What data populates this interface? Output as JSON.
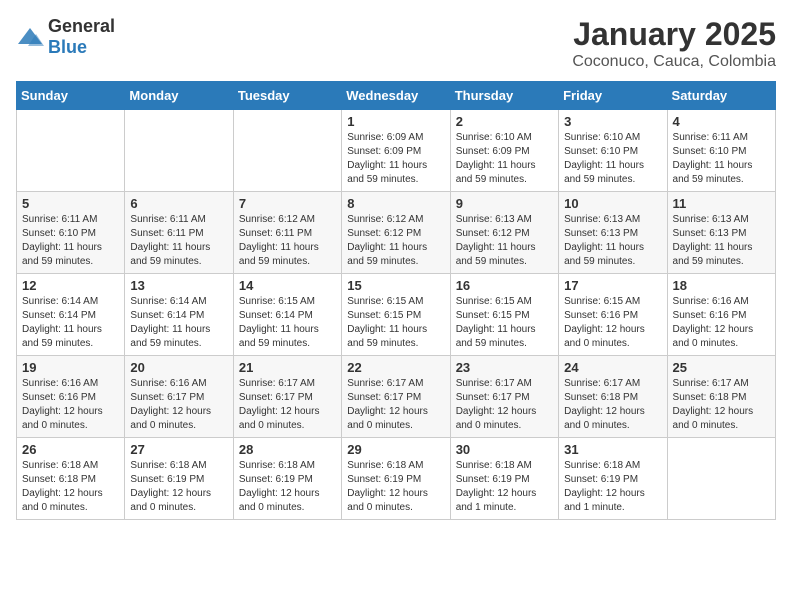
{
  "header": {
    "logo_general": "General",
    "logo_blue": "Blue",
    "month_year": "January 2025",
    "location": "Coconuco, Cauca, Colombia"
  },
  "days_of_week": [
    "Sunday",
    "Monday",
    "Tuesday",
    "Wednesday",
    "Thursday",
    "Friday",
    "Saturday"
  ],
  "weeks": [
    [
      {
        "day": "",
        "info": ""
      },
      {
        "day": "",
        "info": ""
      },
      {
        "day": "",
        "info": ""
      },
      {
        "day": "1",
        "info": "Sunrise: 6:09 AM\nSunset: 6:09 PM\nDaylight: 11 hours and 59 minutes."
      },
      {
        "day": "2",
        "info": "Sunrise: 6:10 AM\nSunset: 6:09 PM\nDaylight: 11 hours and 59 minutes."
      },
      {
        "day": "3",
        "info": "Sunrise: 6:10 AM\nSunset: 6:10 PM\nDaylight: 11 hours and 59 minutes."
      },
      {
        "day": "4",
        "info": "Sunrise: 6:11 AM\nSunset: 6:10 PM\nDaylight: 11 hours and 59 minutes."
      }
    ],
    [
      {
        "day": "5",
        "info": "Sunrise: 6:11 AM\nSunset: 6:10 PM\nDaylight: 11 hours and 59 minutes."
      },
      {
        "day": "6",
        "info": "Sunrise: 6:11 AM\nSunset: 6:11 PM\nDaylight: 11 hours and 59 minutes."
      },
      {
        "day": "7",
        "info": "Sunrise: 6:12 AM\nSunset: 6:11 PM\nDaylight: 11 hours and 59 minutes."
      },
      {
        "day": "8",
        "info": "Sunrise: 6:12 AM\nSunset: 6:12 PM\nDaylight: 11 hours and 59 minutes."
      },
      {
        "day": "9",
        "info": "Sunrise: 6:13 AM\nSunset: 6:12 PM\nDaylight: 11 hours and 59 minutes."
      },
      {
        "day": "10",
        "info": "Sunrise: 6:13 AM\nSunset: 6:13 PM\nDaylight: 11 hours and 59 minutes."
      },
      {
        "day": "11",
        "info": "Sunrise: 6:13 AM\nSunset: 6:13 PM\nDaylight: 11 hours and 59 minutes."
      }
    ],
    [
      {
        "day": "12",
        "info": "Sunrise: 6:14 AM\nSunset: 6:14 PM\nDaylight: 11 hours and 59 minutes."
      },
      {
        "day": "13",
        "info": "Sunrise: 6:14 AM\nSunset: 6:14 PM\nDaylight: 11 hours and 59 minutes."
      },
      {
        "day": "14",
        "info": "Sunrise: 6:15 AM\nSunset: 6:14 PM\nDaylight: 11 hours and 59 minutes."
      },
      {
        "day": "15",
        "info": "Sunrise: 6:15 AM\nSunset: 6:15 PM\nDaylight: 11 hours and 59 minutes."
      },
      {
        "day": "16",
        "info": "Sunrise: 6:15 AM\nSunset: 6:15 PM\nDaylight: 11 hours and 59 minutes."
      },
      {
        "day": "17",
        "info": "Sunrise: 6:15 AM\nSunset: 6:16 PM\nDaylight: 12 hours and 0 minutes."
      },
      {
        "day": "18",
        "info": "Sunrise: 6:16 AM\nSunset: 6:16 PM\nDaylight: 12 hours and 0 minutes."
      }
    ],
    [
      {
        "day": "19",
        "info": "Sunrise: 6:16 AM\nSunset: 6:16 PM\nDaylight: 12 hours and 0 minutes."
      },
      {
        "day": "20",
        "info": "Sunrise: 6:16 AM\nSunset: 6:17 PM\nDaylight: 12 hours and 0 minutes."
      },
      {
        "day": "21",
        "info": "Sunrise: 6:17 AM\nSunset: 6:17 PM\nDaylight: 12 hours and 0 minutes."
      },
      {
        "day": "22",
        "info": "Sunrise: 6:17 AM\nSunset: 6:17 PM\nDaylight: 12 hours and 0 minutes."
      },
      {
        "day": "23",
        "info": "Sunrise: 6:17 AM\nSunset: 6:17 PM\nDaylight: 12 hours and 0 minutes."
      },
      {
        "day": "24",
        "info": "Sunrise: 6:17 AM\nSunset: 6:18 PM\nDaylight: 12 hours and 0 minutes."
      },
      {
        "day": "25",
        "info": "Sunrise: 6:17 AM\nSunset: 6:18 PM\nDaylight: 12 hours and 0 minutes."
      }
    ],
    [
      {
        "day": "26",
        "info": "Sunrise: 6:18 AM\nSunset: 6:18 PM\nDaylight: 12 hours and 0 minutes."
      },
      {
        "day": "27",
        "info": "Sunrise: 6:18 AM\nSunset: 6:19 PM\nDaylight: 12 hours and 0 minutes."
      },
      {
        "day": "28",
        "info": "Sunrise: 6:18 AM\nSunset: 6:19 PM\nDaylight: 12 hours and 0 minutes."
      },
      {
        "day": "29",
        "info": "Sunrise: 6:18 AM\nSunset: 6:19 PM\nDaylight: 12 hours and 0 minutes."
      },
      {
        "day": "30",
        "info": "Sunrise: 6:18 AM\nSunset: 6:19 PM\nDaylight: 12 hours and 1 minute."
      },
      {
        "day": "31",
        "info": "Sunrise: 6:18 AM\nSunset: 6:19 PM\nDaylight: 12 hours and 1 minute."
      },
      {
        "day": "",
        "info": ""
      }
    ]
  ]
}
